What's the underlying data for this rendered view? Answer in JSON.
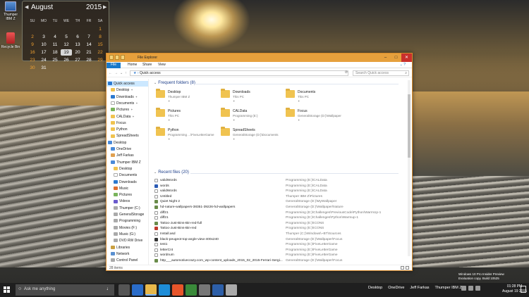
{
  "desktop": {
    "icons": [
      {
        "label": "Thumper IBM Z",
        "icon": "computer-icon"
      },
      {
        "label": "Recycle Bin",
        "icon": "recycle-bin-icon"
      }
    ],
    "watermark": {
      "line1": "Windows 10 Pro Insider Preview",
      "line2": "Evaluation copy. Build 10525"
    }
  },
  "calendar": {
    "month": "August",
    "year": "2015",
    "weekdays": [
      "SU",
      "MO",
      "TU",
      "WE",
      "TH",
      "FR",
      "SA"
    ],
    "today": "19"
  },
  "explorer": {
    "title": "File Explorer",
    "tabs": [
      "File",
      "Home",
      "Share",
      "View"
    ],
    "address": "Quick access",
    "search_placeholder": "Search Quick access",
    "status": "28 items",
    "nav": [
      {
        "label": "Quick access",
        "icon": "star-icon",
        "selected": true
      },
      {
        "label": "Desktop",
        "icon": "folder-icon",
        "pinned": true
      },
      {
        "label": "Downloads",
        "icon": "download-icon",
        "pinned": true
      },
      {
        "label": "Documents",
        "icon": "document-icon",
        "pinned": true
      },
      {
        "label": "Pictures",
        "icon": "picture-icon",
        "pinned": true
      },
      {
        "label": "CALData",
        "icon": "folder-icon",
        "pinned": true
      },
      {
        "label": "Focus",
        "icon": "folder-icon"
      },
      {
        "label": "Python",
        "icon": "folder-icon"
      },
      {
        "label": "SpreadSheets",
        "icon": "folder-icon"
      },
      {
        "label": "Desktop",
        "icon": "desktop-icon"
      },
      {
        "label": "OneDrive",
        "icon": "cloud-icon"
      },
      {
        "label": "Jeff Farkas",
        "icon": "user-icon"
      },
      {
        "label": "Thumper IBM Z",
        "icon": "computer-icon"
      },
      {
        "label": "Desktop",
        "icon": "folder-icon"
      },
      {
        "label": "Documents",
        "icon": "document-icon"
      },
      {
        "label": "Downloads",
        "icon": "download-icon"
      },
      {
        "label": "Music",
        "icon": "music-icon"
      },
      {
        "label": "Pictures",
        "icon": "picture-icon"
      },
      {
        "label": "Videos",
        "icon": "video-icon"
      },
      {
        "label": "Thumper (C:)",
        "icon": "drive-icon"
      },
      {
        "label": "GeneralStorage",
        "icon": "drive-icon"
      },
      {
        "label": "Programming",
        "icon": "drive-icon"
      },
      {
        "label": "Movies (F:)",
        "icon": "drive-icon"
      },
      {
        "label": "Music (G:)",
        "icon": "drive-icon"
      },
      {
        "label": "DVD RW Drive",
        "icon": "drive-icon"
      },
      {
        "label": "Libraries",
        "icon": "library-icon"
      },
      {
        "label": "Network",
        "icon": "network-icon"
      },
      {
        "label": "Control Panel",
        "icon": "control-panel-icon"
      }
    ],
    "frequent_header": "Frequent folders (8)",
    "frequent": [
      {
        "name": "Desktop",
        "sub": "Thumper IBM Z"
      },
      {
        "name": "Downloads",
        "sub": "This PC"
      },
      {
        "name": "Documents",
        "sub": "This PC"
      },
      {
        "name": "Pictures",
        "sub": "This PC"
      },
      {
        "name": "CALData",
        "sub": "Programming (E:)"
      },
      {
        "name": "Focus",
        "sub": "GeneralStorage (D:)\\Wallpaper"
      },
      {
        "name": "Python",
        "sub": "Programming ...\\FiveLetterGame"
      },
      {
        "name": "SpreadSheets",
        "sub": "GeneralStorage (D:)\\Documents"
      }
    ],
    "recent_header": "Recent files (20)",
    "recent": [
      {
        "name": "validWords",
        "path": "Programming (E:)\\CALData",
        "icon": "text-file-icon"
      },
      {
        "name": "words",
        "path": "Programming (E:)\\CALData",
        "icon": "word-file-icon"
      },
      {
        "name": "validWords",
        "path": "Programming (E:)\\CALData",
        "icon": "text-file-icon"
      },
      {
        "name": "Untitled",
        "path": "Thumper IBM Z\\Pictures",
        "icon": "text-file-icon"
      },
      {
        "name": "Quiet Night 2",
        "path": "GeneralStorage (D:)\\MyWallpaper",
        "icon": "image-file-icon"
      },
      {
        "name": "hd-nature-wallpapers-38351-39226-hd-wallpapers",
        "path": "GeneralStorage (D:)\\Wallpaper\\Nature",
        "icon": "image-file-icon"
      },
      {
        "name": "diff21",
        "path": "Programming (E:)\\Challenges\\PreviousCode\\Python\\WarmUp-1",
        "icon": "text-file-icon"
      },
      {
        "name": "diff21",
        "path": "Programming (E:)\\Challenges\\Python\\Warmup-1",
        "icon": "text-file-icon"
      },
      {
        "name": "Tattoo-Just-Bins-Bin-red-full",
        "path": "Programming (E:)\\ICONS",
        "icon": "image-file-icon"
      },
      {
        "name": "Tattoo-Just-Bins-Bin-red",
        "path": "Programming (E:)\\ICONS",
        "icon": "red-image-icon"
      },
      {
        "name": "Install.asd",
        "path": "Thumper (C:)\\Windows\\~BT\\Sources",
        "icon": "text-file-icon"
      },
      {
        "name": "black-peugeot-top-angle-view-400x240",
        "path": "GeneralStorage (D:)\\Wallpaper\\Focus",
        "icon": "car-image-icon"
      },
      {
        "name": "test1",
        "path": "Programming (E:)\\FiveLetterGame",
        "icon": "text-file-icon"
      },
      {
        "name": "letterCnt",
        "path": "Programming (E:)\\FiveLetterGame",
        "icon": "text-file-icon"
      },
      {
        "name": "wordnum",
        "path": "Programming (E:)\\FiveLetterGame",
        "icon": "text-file-icon"
      },
      {
        "name": "http___automotivecrazy.com_wp-content_uploads_2015_02_2015-Ferrari-Sergi...",
        "path": "GeneralStorage (D:)\\Wallpaper\\Focus",
        "icon": "image-file-icon"
      }
    ]
  },
  "taskbar": {
    "search_placeholder": "Ask me anything",
    "right_items": [
      "Desktop",
      "OneDrive",
      "Jeff Farkas",
      "Thumper IBM Z"
    ],
    "time": "01:28 PM",
    "date": "August 19 2015"
  }
}
